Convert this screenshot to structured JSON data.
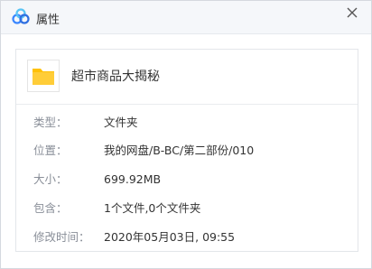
{
  "window": {
    "title": "属性",
    "close_label": "×"
  },
  "file": {
    "name": "超市商品大揭秘"
  },
  "properties": [
    {
      "label": "类型：",
      "value": "文件夹"
    },
    {
      "label": "位置：",
      "value": "我的网盘/B-BC/第二部份/010"
    },
    {
      "label": "大小：",
      "value": "699.92MB"
    },
    {
      "label": "包含：",
      "value": "1个文件,0个文件夹"
    },
    {
      "label": "修改时间：",
      "value": "2020年05月03日, 09:55"
    }
  ],
  "colors": {
    "accent": "#3a86ff",
    "folder": "#ffc107"
  },
  "icons": {
    "app": "cloud-logo-icon",
    "close": "close-icon",
    "file": "folder-icon"
  }
}
